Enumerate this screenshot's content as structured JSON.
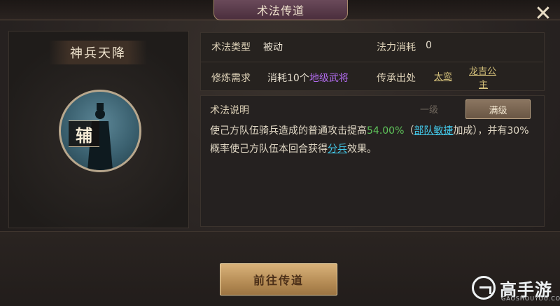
{
  "window": {
    "title": "术法传道"
  },
  "skill": {
    "name": "神兵天降",
    "role_badge": "辅"
  },
  "info": {
    "type_label": "术法类型",
    "type_value": "被动",
    "cost_label": "法力消耗",
    "cost_value": "0",
    "req_label": "修炼需求",
    "req_prefix": "消耗10个",
    "req_highlight": "地级武将",
    "source_label": "传承出处",
    "source_link1": "太鸾",
    "source_link2_line1": "龙吉公",
    "source_link2_line2": "主"
  },
  "desc": {
    "label": "术法说明",
    "tab_level1": "一级",
    "tab_max": "满级",
    "p1": "使己方队伍骑兵造成的普通攻击提高",
    "value": "54.00%",
    "p2": "（",
    "link1": "部队敏捷",
    "p3": "加成），并有30%概率使己方队伍本回合获得",
    "link2": "分兵",
    "p4": "效果。"
  },
  "action": {
    "go_label": "前往传道"
  },
  "watermark": {
    "name": "高手游",
    "domain": "GAOSHOUYOU.COM"
  },
  "colors": {
    "highlight_purple": "#b36cf0",
    "value_green": "#5fc45a",
    "keyword_cyan": "#43c8e8",
    "button_gold": "#c9a066"
  }
}
